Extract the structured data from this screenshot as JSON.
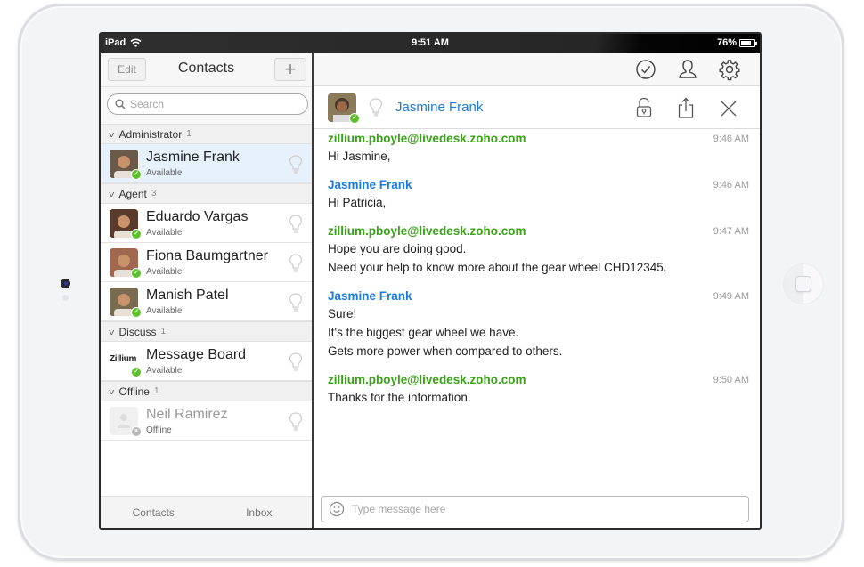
{
  "status_bar": {
    "device": "iPad",
    "time": "9:51 AM",
    "battery": "76%",
    "battery_level": 0.76
  },
  "contacts_panel": {
    "edit_label": "Edit",
    "title": "Contacts",
    "add_label": "+",
    "search_placeholder": "Search",
    "groups": [
      {
        "name": "Administrator",
        "count": "1",
        "contacts": [
          {
            "name": "Jasmine Frank",
            "status": "Available",
            "selected": true,
            "avatar_color": "#6b5a4a"
          }
        ]
      },
      {
        "name": "Agent",
        "count": "3",
        "contacts": [
          {
            "name": "Eduardo Vargas",
            "status": "Available",
            "avatar_color": "#5a3a2a"
          },
          {
            "name": "Fiona Baumgartner",
            "status": "Available",
            "avatar_color": "#a0684e"
          },
          {
            "name": "Manish Patel",
            "status": "Available",
            "avatar_color": "#7a6a50"
          }
        ]
      },
      {
        "name": "Discuss",
        "count": "1",
        "contacts": [
          {
            "name": "Message Board",
            "status": "Available",
            "logo": "Zillium"
          }
        ]
      },
      {
        "name": "Offline",
        "count": "1",
        "contacts": [
          {
            "name": "Neil Ramirez",
            "status": "Offline",
            "offline": true
          }
        ]
      }
    ],
    "tabs": [
      "Contacts",
      "Inbox"
    ]
  },
  "chat": {
    "contact_name": "Jasmine Frank",
    "toolbar_icons": [
      "check-circle-icon",
      "user-icon",
      "gear-icon"
    ],
    "header_icons": [
      "unlock-icon",
      "share-icon",
      "close-icon"
    ],
    "messages": [
      {
        "sender": "zillium.pboyle@livedesk.zoho.com",
        "role": "agent",
        "time": "9:46 AM",
        "lines": [
          "Hi Jasmine,"
        ]
      },
      {
        "sender": "Jasmine Frank",
        "role": "visitor",
        "time": "9:46 AM",
        "lines": [
          "Hi Patricia,"
        ]
      },
      {
        "sender": "zillium.pboyle@livedesk.zoho.com",
        "role": "agent",
        "time": "9:47 AM",
        "lines": [
          "Hope you are doing good.",
          "Need your help to know more about the gear wheel CHD12345."
        ]
      },
      {
        "sender": "Jasmine Frank",
        "role": "visitor",
        "time": "9:49 AM",
        "lines": [
          "Sure!",
          "It's the biggest gear wheel we have.",
          "Gets more power when compared to others."
        ]
      },
      {
        "sender": "zillium.pboyle@livedesk.zoho.com",
        "role": "agent",
        "time": "9:50 AM",
        "lines": [
          "Thanks for the information."
        ]
      }
    ],
    "composer_placeholder": "Type message here"
  },
  "colors": {
    "agent_green": "#3aa119",
    "visitor_blue": "#1a7be0",
    "available_green": "#5cc02a",
    "selected_row": "#e6f1fc"
  }
}
